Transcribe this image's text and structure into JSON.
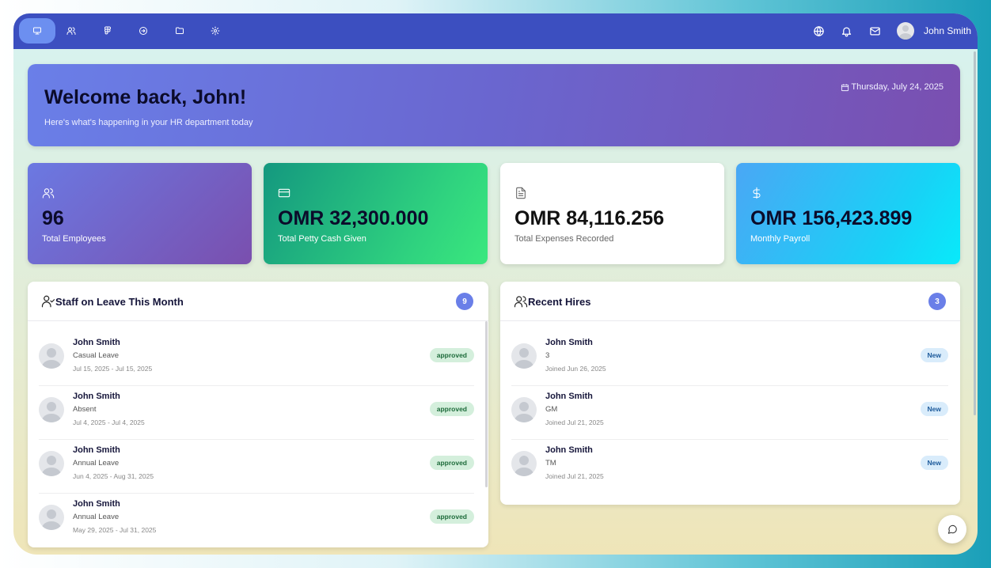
{
  "nav": {
    "icons": [
      "monitor-icon",
      "users-icon",
      "figma-icon",
      "arrow-circle-icon",
      "folder-icon",
      "settings-icon"
    ],
    "right_icons": [
      "globe-icon",
      "bell-icon",
      "mail-icon"
    ],
    "user_name": "John Smith"
  },
  "banner": {
    "title": "Welcome back, John!",
    "subtitle": "Here's what's happening in your HR department today",
    "date": "Thursday, July 24, 2025"
  },
  "stats": [
    {
      "value": "96",
      "label": "Total Employees",
      "icon": "users-icon"
    },
    {
      "value": "OMR 32,300.000",
      "label": "Total Petty Cash Given",
      "icon": "credit-card-icon"
    },
    {
      "value": "OMR 84,116.256",
      "label": "Total Expenses Recorded",
      "icon": "file-text-icon"
    },
    {
      "value": "OMR 156,423.899",
      "label": "Monthly Payroll",
      "icon": "dollar-icon"
    }
  ],
  "leave_panel": {
    "title": "Staff on Leave This Month",
    "count": "9",
    "items": [
      {
        "name": "John Smith",
        "type": "Casual Leave",
        "dates": "Jul 15, 2025 - Jul 15, 2025",
        "status": "approved"
      },
      {
        "name": "John Smith",
        "type": "Absent",
        "dates": "Jul 4, 2025 - Jul 4, 2025",
        "status": "approved"
      },
      {
        "name": "John Smith",
        "type": "Annual Leave",
        "dates": "Jun 4, 2025 - Aug 31, 2025",
        "status": "approved"
      },
      {
        "name": "John Smith",
        "type": "Annual Leave",
        "dates": "May 29, 2025 - Jul 31, 2025",
        "status": "approved"
      }
    ]
  },
  "hires_panel": {
    "title": "Recent Hires",
    "count": "3",
    "items": [
      {
        "name": "John Smith",
        "role": "3",
        "joined": "Joined Jun 26, 2025",
        "tag": "New"
      },
      {
        "name": "John Smith",
        "role": "GM",
        "joined": "Joined Jul 21, 2025",
        "tag": "New"
      },
      {
        "name": "John Smith",
        "role": "TM",
        "joined": "Joined Jul 21, 2025",
        "tag": "New"
      }
    ]
  },
  "colors": {
    "topbar": "#3c4fc0",
    "accent": "#6a7fe8",
    "approved_bg": "#d4efdc",
    "new_bg": "#d9ecfb"
  }
}
